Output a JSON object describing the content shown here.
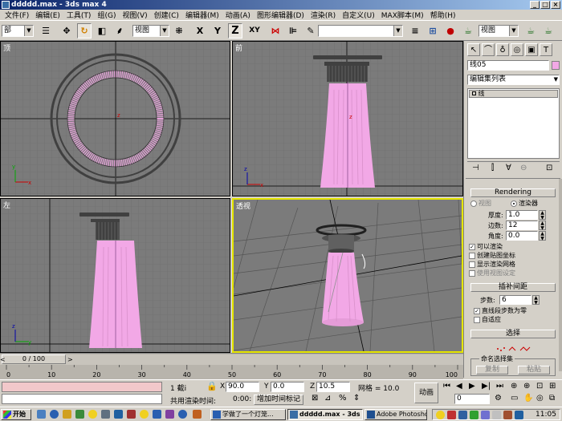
{
  "window": {
    "title": "ddddd.max - 3ds max 4"
  },
  "menu": [
    "文件(F)",
    "编辑(E)",
    "工具(T)",
    "组(G)",
    "视图(V)",
    "创建(C)",
    "编辑器(M)",
    "动画(A)",
    "图形编辑器(D)",
    "渲染(R)",
    "自定义(U)",
    "MAX脚本(M)",
    "帮助(H)"
  ],
  "toolbar": {
    "selection_filter": "部",
    "ref_coord": "视图",
    "axis_x": "X",
    "axis_y": "Y",
    "axis_z": "Z",
    "axis_xy": "XY",
    "named_sel": "",
    "render_view": "视图"
  },
  "viewports": {
    "top": "顶",
    "front": "前",
    "left": "左",
    "perspective": "透视"
  },
  "command_panel": {
    "object_name": "线05",
    "modifier_list": "编辑集列表",
    "stack_item": "线",
    "rendering": {
      "title": "Rendering",
      "radio_viewport": "视图",
      "radio_renderer": "渲染器",
      "thickness_label": "厚度:",
      "thickness": "1.0",
      "sides_label": "边数:",
      "sides": "12",
      "angle_label": "角度:",
      "angle": "0.0",
      "renderable": "可以渲染",
      "gen_mapping": "创建贴图坐标",
      "display_mesh": "显示渲染网格",
      "use_viewport": "使用视图设定"
    },
    "interpolation": {
      "title": "插补间距",
      "steps_label": "步数:",
      "steps": "6",
      "optimize": "直线段步数为零",
      "adaptive": "自适应"
    },
    "selection": {
      "title": "选择",
      "named_sets": "命名选择集",
      "copy": "复制",
      "paste": "粘贴"
    }
  },
  "timeline": {
    "frame_display": "0 / 100",
    "ticks": [
      "0",
      "10",
      "20",
      "30",
      "40",
      "50",
      "60",
      "70",
      "80",
      "90",
      "100"
    ]
  },
  "status": {
    "selected": "1 截i",
    "x_label": "X",
    "x": "90.0",
    "y_label": "Y",
    "y": "0.0",
    "z_label": "Z",
    "z": "10.5",
    "grid_label": "网格 = 10.0",
    "animate": "动画",
    "frame": "0",
    "shared_render_time": "共用渲染时间:",
    "render_time": "0:00:",
    "add_time_tag": "增加时间标记"
  },
  "taskbar": {
    "start": "开始",
    "tasks": [
      "学做了一个灯笼...",
      "ddddd.max - 3ds ...",
      "Adobe Photoshop"
    ],
    "clock": "11:05"
  },
  "colors": {
    "viewport_bg": "#7b7b7b",
    "grid": "#6c6c6c",
    "lamp_pink": "#f2a8e6",
    "active_border": "#e6e600"
  }
}
